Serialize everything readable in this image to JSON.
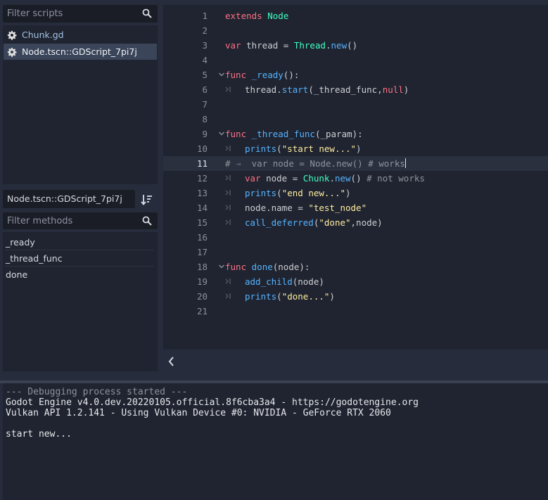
{
  "scripts_panel": {
    "filter_placeholder": "Filter scripts",
    "items": [
      {
        "label": "Chunk.gd",
        "icon": "gear-icon"
      },
      {
        "label": "Node.tscn::GDScript_7pi7j",
        "icon": "gear-icon"
      }
    ]
  },
  "current_script": "Node.tscn::GDScript_7pi7j",
  "methods_panel": {
    "filter_placeholder": "Filter methods",
    "items": [
      "_ready",
      "_thread_func",
      "done"
    ]
  },
  "editor": {
    "current_line": 11,
    "line_numbers": [
      "1",
      "2",
      "3",
      "4",
      "5",
      "6",
      "7",
      "8",
      "9",
      "10",
      "11",
      "12",
      "13",
      "14",
      "15",
      "16",
      "17",
      "18",
      "19",
      "20",
      "21"
    ]
  },
  "output": {
    "lines": [
      "--- Debugging process started ---",
      "Godot Engine v4.0.dev.20220105.official.8f6cba3a4 - https://godotengine.org",
      "Vulkan API 1.2.141 - Using Vulkan Device #0: NVIDIA - GeForce RTX 2060",
      "",
      "start new..."
    ]
  },
  "colors": {
    "keyword": "#ff7085",
    "type": "#42ffc2",
    "function": "#57b3ff",
    "string": "#ffeda1",
    "comment": "#8f949c"
  }
}
